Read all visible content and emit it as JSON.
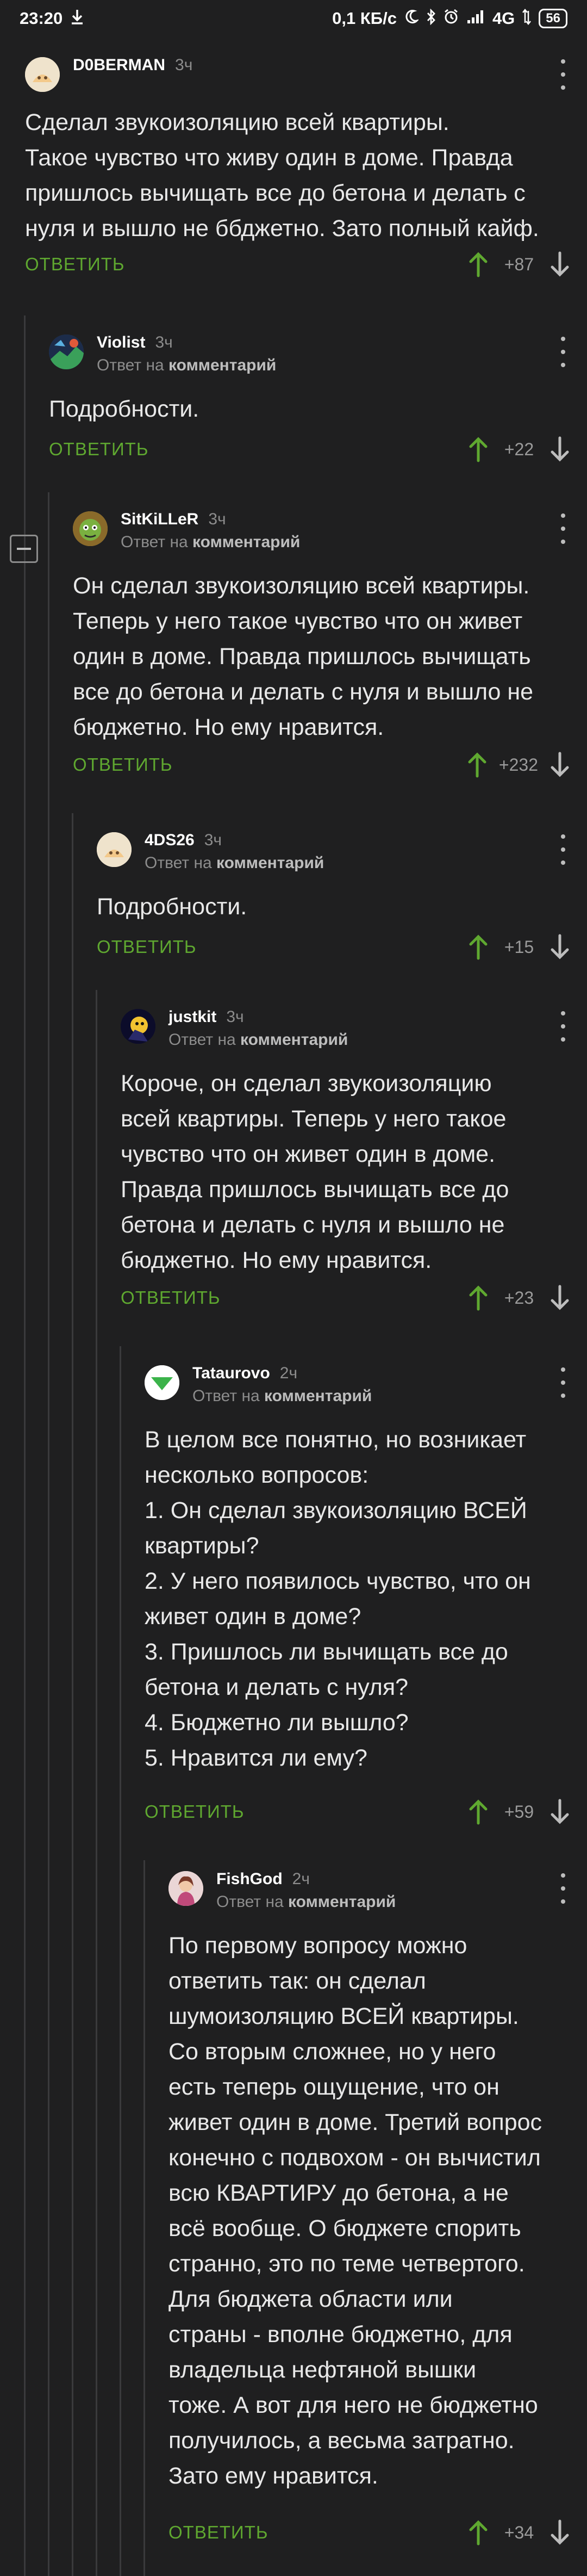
{
  "status": {
    "time": "23:20",
    "speed": "0,1 КБ/с",
    "network": "4G",
    "battery": "56"
  },
  "labels": {
    "reply_to": "Ответ на",
    "comment_word": "комментарий",
    "answer": "ОТВЕТИТЬ"
  },
  "comments": [
    {
      "author": "D0BERMAN",
      "time": "3ч",
      "text": "Сделал звукоизоляцию всей квартиры.\nТакое чувство что живу один в доме. Правда\nпришлось вычищать все до бетона и делать с\nнуля и вышло не ббджетно. Зато полный кайф.",
      "score": "+87"
    },
    {
      "author": "Violist",
      "time": "3ч",
      "text": "Подробности.",
      "score": "+22"
    },
    {
      "author": "SitKiLLeR",
      "time": "3ч",
      "text": "Он сделал звукоизоляцию всей квартиры.\nТеперь у него такое чувство что он живет\nодин в доме. Правда пришлось вычищать\nвсе до бетона и делать с нуля и вышло не\nбюджетно. Но ему нравится.",
      "score": "+232"
    },
    {
      "author": "4DS26",
      "time": "3ч",
      "text": "Подробности.",
      "score": "+15"
    },
    {
      "author": "justkit",
      "time": "3ч",
      "text": "Короче, он сделал звукоизоляцию\nвсей квартиры. Теперь у него такое\nчувство что он живет один в доме.\nПравда пришлось вычищать все до\nбетона и делать с нуля и вышло не\nбюджетно. Но ему нравится.",
      "score": "+23"
    },
    {
      "author": "Tataurovo",
      "time": "2ч",
      "text": "В целом все понятно, но возникает\nнесколько вопросов:\n1. Он сделал звукоизоляцию ВСЕЙ\nквартиры?\n2. У него появилось чувство, что он\nживет один в доме?\n3. Пришлось ли вычищать все до\nбетона и делать с нуля?\n4. Бюджетно ли вышло?\n5. Нравится ли ему?",
      "score": "+59"
    },
    {
      "author": "FishGod",
      "time": "2ч",
      "text": "По первому вопросу можно\nответить так: он сделал\nшумоизоляцию ВСЕЙ квартиры.\nСо вторым сложнее, но у него\nесть теперь ощущение, что он\nживет один в доме. Третий вопрос\nконечно с подвохом - он вычистил\nвсю КВАРТИРУ до бетона, а не\nвсё вообще. О бюджете спорить\nстранно, это по теме четвертого.\nДля бюджета области или\nстраны - вполне бюджетно, для\nвладельца нефтяной вышки\nтоже. А вот для него не бюджетно\nполучилось, а весьма затратно.\nЗато ему нравится.",
      "score": "+34"
    }
  ]
}
